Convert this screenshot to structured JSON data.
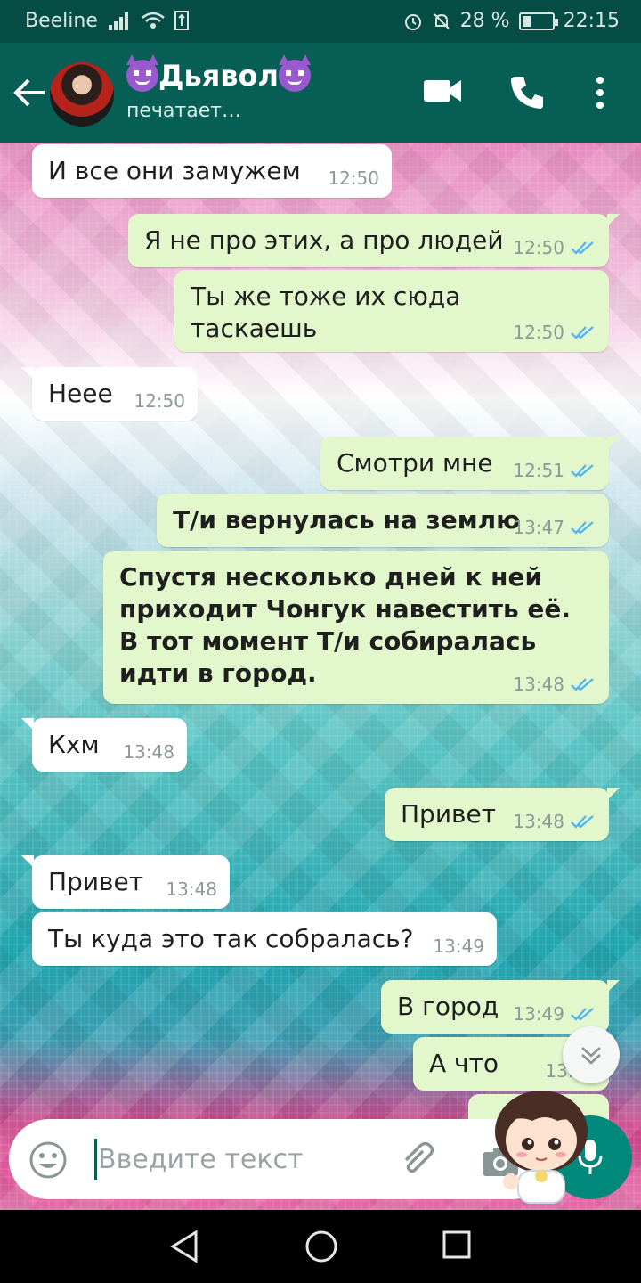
{
  "status_bar": {
    "carrier": "Beeline",
    "battery": "28 %",
    "battery_level": 0.28,
    "time": "22:15"
  },
  "header": {
    "contact_name": "Дьявол",
    "status": "печатает…",
    "icons": [
      "back-arrow-icon",
      "video-call-icon",
      "phone-icon",
      "more-vert-icon"
    ]
  },
  "messages": [
    {
      "dir": "in",
      "text": "И все они замужем",
      "time": "12:50"
    },
    {
      "dir": "out",
      "text": "Я не про этих, а про людей",
      "time": "12:50"
    },
    {
      "dir": "out",
      "text": "Ты же тоже их сюда таскаешь",
      "time": "12:50"
    },
    {
      "dir": "in",
      "text": "Неее",
      "time": "12:50"
    },
    {
      "dir": "out",
      "text": "Смотри мне",
      "time": "12:51"
    },
    {
      "dir": "out",
      "text": "Т/и вернулась на землю",
      "time": "13:47",
      "bold": true
    },
    {
      "dir": "out",
      "text": "Спустя несколько дней к ней приходит Чонгук навестить её. В тот момент Т/и собиралась идти в город.",
      "time": "13:48",
      "bold": true
    },
    {
      "dir": "in",
      "text": "Кхм",
      "time": "13:48"
    },
    {
      "dir": "out",
      "text": "Привет",
      "time": "13:48"
    },
    {
      "dir": "in",
      "text": "Привет",
      "time": "13:48"
    },
    {
      "dir": "in",
      "text": "Ты куда это так собралась?",
      "time": "13:49"
    },
    {
      "dir": "out",
      "text": "В город",
      "time": "13:49"
    },
    {
      "dir": "out",
      "text": "А что",
      "time": "13:49"
    }
  ],
  "input": {
    "placeholder": "Введите текст"
  },
  "colors": {
    "header": "#075e54",
    "status_bar": "#054d44",
    "bubble_out": "#e2f7cb",
    "bubble_in": "#ffffff",
    "read_tick": "#4fb3f6",
    "mic_button": "#00897b"
  }
}
